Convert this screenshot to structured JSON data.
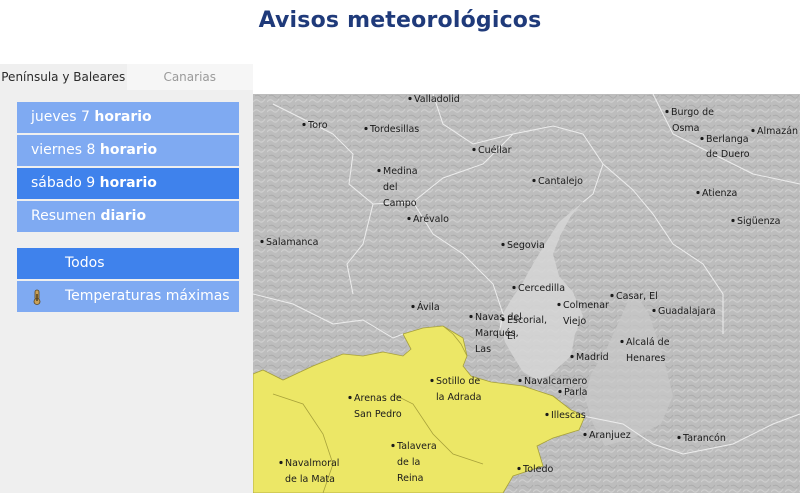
{
  "header": {
    "title": "Avisos meteorológicos"
  },
  "tabs": [
    {
      "label": "Península y Baleares"
    },
    {
      "label": "Canarias"
    }
  ],
  "days": [
    {
      "day": "jueves 7",
      "mode": "horario"
    },
    {
      "day": "viernes 8",
      "mode": "horario"
    },
    {
      "day": "sábado 9",
      "mode": "horario"
    },
    {
      "day": "Resumen",
      "mode": "diario"
    }
  ],
  "layers": [
    {
      "label": "Todos"
    },
    {
      "label": "Temperaturas máximas",
      "icon": "thermometer-icon"
    }
  ],
  "colors": {
    "warning_yellow": "#ece766",
    "active_button": "#3f82ec",
    "button": "#7faaf2",
    "title": "#1f3a7a"
  },
  "map": {
    "cities": [
      "Valladolid",
      "Toro",
      "Tordesillas",
      "Burgo de",
      "Osma",
      "Berlanga",
      "de Duero",
      "Almazán",
      "Cuéllar",
      "Medina",
      "del",
      "Campo",
      "Cantalejo",
      "Arévalo",
      "Atienza",
      "Sigüenza",
      "Salamanca",
      "Segovia",
      "Cercedilla",
      "Ávila",
      "Colmenar",
      "Viejo",
      "Casar, El",
      "Guadalajara",
      "Navas del",
      "Marqués,",
      "Las",
      "Escorial,",
      "El",
      "Madrid",
      "Alcalá de",
      "Henares",
      "Sotillo de",
      "la Adrada",
      "Navalcarnero",
      "Parla",
      "Arenas de",
      "San Pedro",
      "Illescas",
      "Aranjuez",
      "Tarancón",
      "Talavera",
      "de la",
      "Reina",
      "Navalmoral",
      "de la Mata",
      "Toledo"
    ]
  }
}
